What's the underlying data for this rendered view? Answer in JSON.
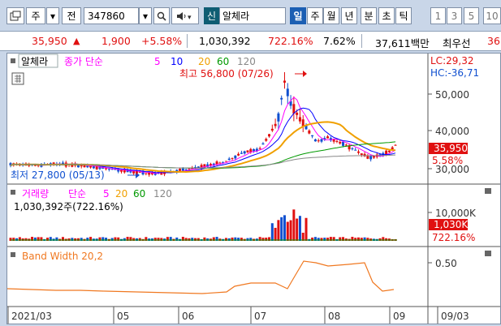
{
  "toolbar": {
    "market": "주",
    "period_label": "전",
    "code": "347860",
    "stock_badge": "신",
    "stock_name": "알체라",
    "timeframes": [
      "일",
      "주",
      "월",
      "년",
      "분",
      "초",
      "틱"
    ],
    "active_timeframe": "일",
    "intervals": [
      "1",
      "3",
      "5",
      "10"
    ]
  },
  "quote": {
    "price": "35,950",
    "change_arrow": "▲",
    "change": "1,900",
    "change_pct": "+5.58%",
    "volume": "1,030,392",
    "volume_ratio": "722.16%",
    "turnover": "7.62%",
    "amount": "37,611백만",
    "last_label": "최우선",
    "last_value": "36"
  },
  "price_panel": {
    "legend_name": "알체라",
    "legend_prefix": "종가 단순",
    "ma_periods": [
      "5",
      "10",
      "20",
      "60",
      "120"
    ],
    "ma_colors": [
      "#ff00ff",
      "#0000ff",
      "#f0a000",
      "#009900",
      "#888888"
    ],
    "high_label": "최고 56,800 (07/26)",
    "low_label": "최저 27,800 (05/13)",
    "lc": "LC:29,32",
    "hc": "HC:-36,71",
    "axis_ticks": [
      "50,000",
      "40,000",
      "30,000"
    ],
    "last_price_tag": "35,950",
    "last_pct": "5.58%"
  },
  "volume_panel": {
    "legend_name": "거래량",
    "legend_prefix": "단순",
    "ma_periods": [
      "5",
      "20",
      "60",
      "120"
    ],
    "value_line": "1,030,392주(722.16%)",
    "axis_ticks": [
      "10,000K"
    ],
    "last_tag": "1,030K",
    "last_pct": "722.16%"
  },
  "band_panel": {
    "legend": "Band Width 20,2",
    "axis_ticks": [
      "0.50"
    ]
  },
  "x_axis": {
    "labels": [
      "2021/03",
      "05",
      "06",
      "07",
      "08",
      "09",
      "09/03"
    ]
  },
  "colors": {
    "up": "#e01010",
    "down": "#1050d0",
    "accent": "#1c5fb3",
    "band": "#f07820"
  }
}
